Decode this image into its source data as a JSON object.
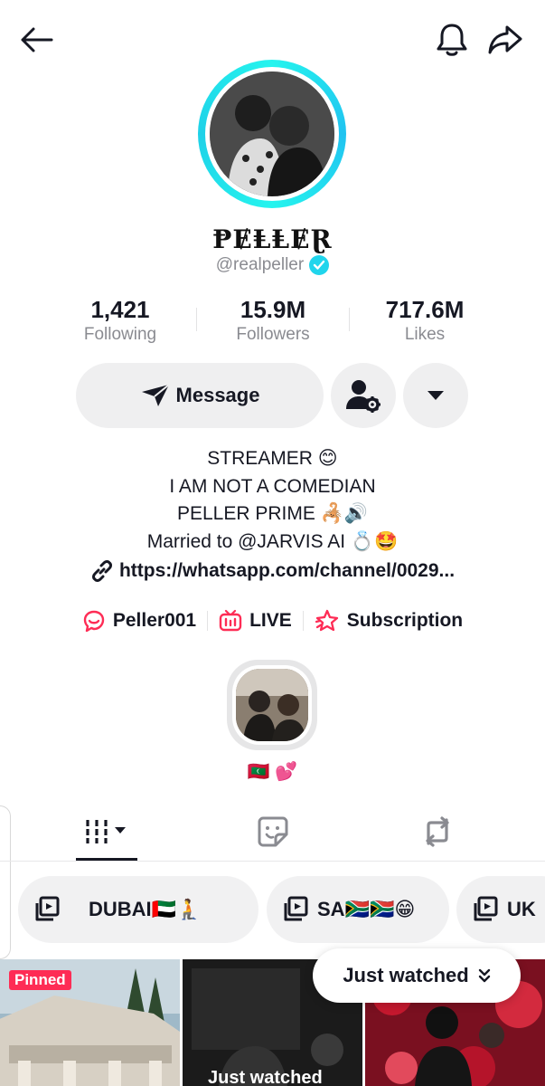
{
  "header": {
    "icons": [
      "back-arrow-icon",
      "bell-icon",
      "share-icon"
    ]
  },
  "profile": {
    "display_name": "ⱣɆⱠⱠɆⱤ",
    "handle": "@realpeller",
    "verified": true
  },
  "stats": [
    {
      "value": "1,421",
      "label": "Following"
    },
    {
      "value": "15.9M",
      "label": "Followers"
    },
    {
      "value": "717.6M",
      "label": "Likes"
    }
  ],
  "actions": {
    "message_label": "Message"
  },
  "bio": {
    "lines": [
      "STREAMER 😊",
      "I AM NOT A COMEDIAN",
      "PELLER PRIME 🦂🔊",
      "Married to @JARVIS AI 💍🤩"
    ],
    "link": "https://whatsapp.com/channel/0029..."
  },
  "links": [
    {
      "label": "Peller001",
      "icon": "chat-bubble-icon"
    },
    {
      "label": "LIVE",
      "icon": "tv-icon"
    },
    {
      "label": "Subscription",
      "icon": "star-icon"
    }
  ],
  "highlight": {
    "caption": "🇲🇻 💕"
  },
  "tabs": [
    {
      "name": "videos",
      "icon": "grid-bars-icon"
    },
    {
      "name": "stickers",
      "icon": "sticker-icon"
    },
    {
      "name": "reposts",
      "icon": "repost-icon"
    }
  ],
  "playlists": [
    {
      "label": "DUBAI🇦🇪🧎"
    },
    {
      "label": "SA🇿🇦🇿🇦😁"
    },
    {
      "label": "UK"
    }
  ],
  "videos": {
    "pinned_label": "Pinned",
    "just_watched_label": "Just watched",
    "cell_caption": "Just watched"
  },
  "colors": {
    "accent": "#fe2c55",
    "ring": "#25f4ee",
    "verified": "#20d5ec"
  }
}
